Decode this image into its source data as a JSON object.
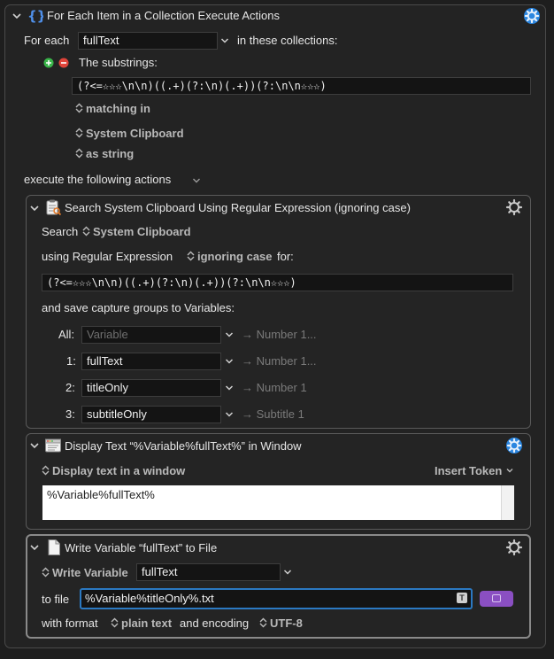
{
  "outer": {
    "title": "For Each Item in a Collection Execute Actions",
    "for_each_label": "For each",
    "variable": "fullText",
    "in_collections_label": "in these collections:",
    "substrings_label": "The substrings:",
    "regex": "(?<=☆☆☆\\n\\n)((.+)(?:\\n)(.+))(?:\\n\\n☆☆☆)",
    "matching_in": "matching in",
    "source": "System Clipboard",
    "as_string": "as string",
    "execute_label": "execute the following actions"
  },
  "search_action": {
    "title": "Search System Clipboard Using Regular Expression (ignoring case)",
    "search_label": "Search",
    "source": "System Clipboard",
    "using_label": "using Regular Expression",
    "case_option": "ignoring case",
    "for_label": "for:",
    "regex": "(?<=☆☆☆\\n\\n)((.+)(?:\\n)(.+))(?:\\n\\n☆☆☆)",
    "save_label": "and save capture groups to Variables:",
    "groups": [
      {
        "label": "All:",
        "value": "",
        "placeholder": "Variable",
        "target": "→ Number 1..."
      },
      {
        "label": "1:",
        "value": "fullText",
        "placeholder": "",
        "target": "→ Number 1..."
      },
      {
        "label": "2:",
        "value": "titleOnly",
        "placeholder": "",
        "target": "→ Number 1"
      },
      {
        "label": "3:",
        "value": "subtitleOnly",
        "placeholder": "",
        "target": "→ Subtitle 1"
      }
    ]
  },
  "display_action": {
    "title": "Display Text “%Variable%fullText%” in Window",
    "mode": "Display text in a window",
    "insert_token": "Insert Token",
    "text": "%Variable%fullText%"
  },
  "write_action": {
    "title": "Write Variable “fullText” to File",
    "write_label": "Write Variable",
    "variable": "fullText",
    "to_file_label": "to file",
    "file_path": "%Variable%titleOnly%.txt",
    "token_glyph": "T",
    "format_label": "with format",
    "format": "plain text",
    "encoding_label": "and encoding",
    "encoding": "UTF-8"
  },
  "colors": {
    "gear_blue": "#2b86e0",
    "focus_blue": "#2b79c2",
    "purple_button": "#8a4fc2",
    "plus_green": "#3ab54a",
    "minus_red": "#e0443a"
  },
  "icons": {
    "collapse": "chevron-down-icon",
    "action_gear": "gear-icon",
    "add": "plus-circle-icon",
    "remove": "minus-circle-icon",
    "popup": "up-down-arrows-icon",
    "search": "clipboard-search-icon",
    "display": "window-icon",
    "write": "document-icon"
  }
}
